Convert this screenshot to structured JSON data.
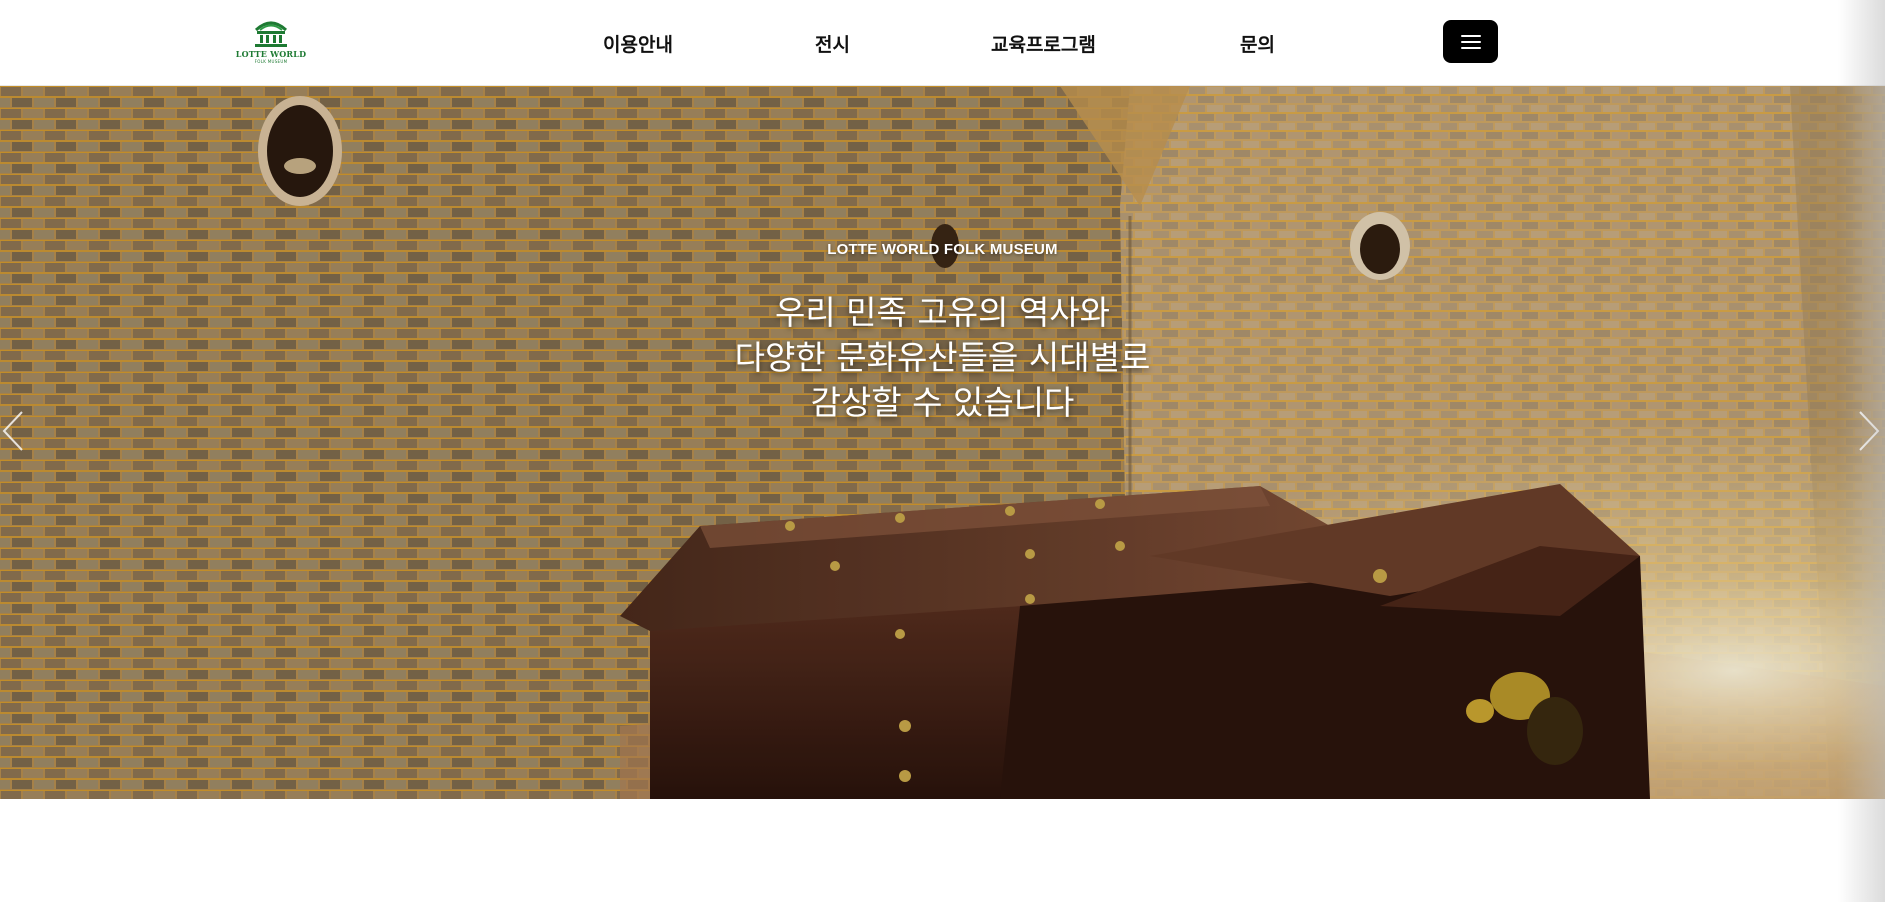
{
  "header": {
    "logo": {
      "name": "LOTTE WORLD",
      "sub": "FOLK MUSEUM",
      "icon": "museum-building-icon",
      "color": "#1e7a33"
    },
    "nav": [
      {
        "label": "이용안내"
      },
      {
        "label": "전시"
      },
      {
        "label": "교육프로그램"
      },
      {
        "label": "문의"
      }
    ],
    "menu_icon": "hamburger-menu-icon"
  },
  "hero": {
    "subtitle": "LOTTE WORLD FOLK MUSEUM",
    "title_lines": [
      "우리 민족 고유의 역사와",
      "다양한 문화유산들을 시대별로",
      "감상할 수 있습니다"
    ],
    "prev_icon": "chevron-left-icon",
    "next_icon": "chevron-right-icon"
  }
}
